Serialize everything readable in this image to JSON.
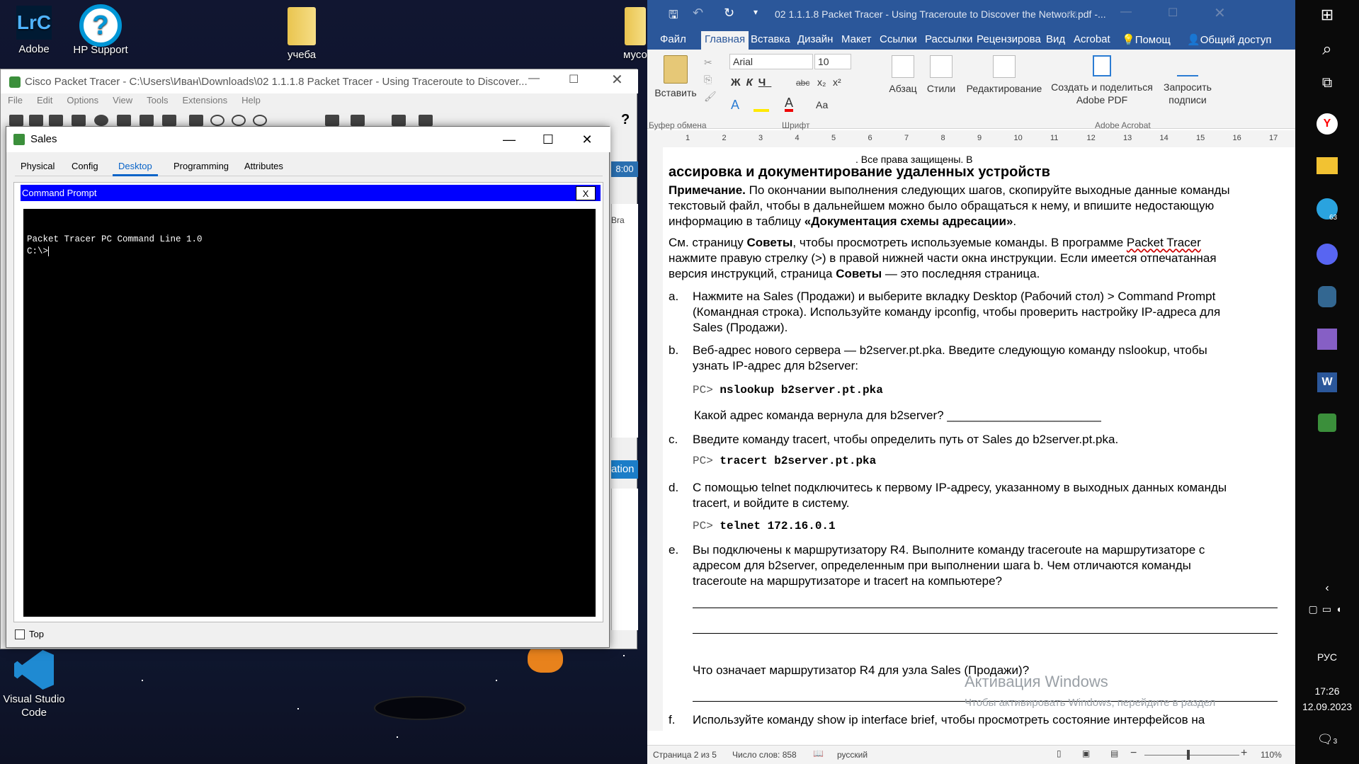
{
  "desktop": {
    "icons": [
      {
        "label": "Adobe",
        "icon": "lightroom-classic-icon",
        "glyph": "LrC"
      },
      {
        "label": "HP Support",
        "icon": "hp-support-icon",
        "glyph": "?"
      },
      {
        "label": "учеба",
        "icon": "folder-icon"
      },
      {
        "label": "мусо",
        "icon": "folder-icon"
      },
      {
        "label": "Visual Studio Code",
        "icon": "vscode-icon"
      }
    ]
  },
  "packet_tracer": {
    "title": "Cisco Packet Tracer - C:\\Users\\Иван\\Downloads\\02 1.1.1.8 Packet Tracer - Using Traceroute to Discover...",
    "menu": [
      "File",
      "Edit",
      "Options",
      "View",
      "Tools",
      "Extensions",
      "Help"
    ],
    "side_clock": "8:00",
    "side_label": "ation",
    "side_bra": "Bra",
    "help_icon": "?"
  },
  "sales_window": {
    "title": "Sales",
    "tabs": [
      "Physical",
      "Config",
      "Desktop",
      "Programming",
      "Attributes"
    ],
    "active_tab": "Desktop",
    "cmd_title": "Command Prompt",
    "cmd_close": "X",
    "terminal_lines": [
      "Packet Tracer PC Command Line 1.0",
      "C:\\>"
    ],
    "top_checkbox_label": "Top"
  },
  "word": {
    "title": "02 1.1.1.8 Packet Tracer - Using Traceroute to Discover the Network.pdf -...",
    "tabs": [
      "Файл",
      "Главная",
      "Вставка",
      "Дизайн",
      "Макет",
      "Ссылки",
      "Рассылки",
      "Рецензирова",
      "Вид",
      "Acrobat",
      "Помощ",
      "Общий доступ"
    ],
    "active_tab": "Главная",
    "ribbon": {
      "paste": "Вставить",
      "clipboard_group": "Буфер обмена",
      "font_name": "Arial",
      "font_size": "10",
      "font_group": "Шрифт",
      "paragraph": "Абзац",
      "styles": "Стили",
      "editing": "Редактирование",
      "create_pdf": "Создать и поделиться Adobe PDF",
      "request_sign": "Запросить подписи",
      "acrobat_group": "Adobe Acrobat"
    },
    "ruler_marks": [
      "1",
      "2",
      "3",
      "4",
      "5",
      "6",
      "7",
      "8",
      "9",
      "10",
      "11",
      "12",
      "13",
      "14",
      "15",
      "16",
      "17"
    ],
    "doc": {
      "rights": ". Все права защищены. В",
      "heading": "ассировка и документирование удаленных устройств",
      "note_label": "Примечание.",
      "note_l1": " По окончании выполнения следующих шагов, скопируйте выходные данные команды",
      "note_l2": "текстовый файл, чтобы в дальнейшем можно было обращаться к нему, и впишите недостающую",
      "note_l3a": "информацию в таблицу ",
      "note_l3b": "«Документация схемы адресации»",
      "note_l3c": ".",
      "tips_l1a": "См. страницу ",
      "tips_l1b": "Советы",
      "tips_l1c": ", чтобы просмотреть используемые команды. В программе ",
      "tips_l1d": "Packet Tracer",
      "tips_l2": "нажмите правую стрелку (>) в правой нижней части окна инструкции. Если имеется отпечатанная",
      "tips_l3a": "версия инструкций, страница ",
      "tips_l3b": "Советы",
      "tips_l3c": " — это последняя страница.",
      "a_mark": "a.",
      "a_l1": "Нажмите на Sales (Продажи) и выберите вкладку Desktop (Рабочий стол) > Command Prompt",
      "a_l2": "(Командная строка). Используйте команду ipconfig, чтобы проверить настройку IP-адреса для",
      "a_l3": "Sales (Продажи).",
      "b_mark": "b.",
      "b_l1": "Веб-адрес нового сервера — b2server.pt.pka. Введите следующую команду nslookup, чтобы",
      "b_l2": "узнать IP-адрес для b2server:",
      "b_cmd_prompt": "PC> ",
      "b_cmd": "nslookup b2server.pt.pka",
      "b_q": "Какой адрес команда вернула для b2server? _______________________",
      "c_mark": "c.",
      "c_l1": "Введите команду tracert, чтобы определить путь от Sales до b2server.pt.pka.",
      "c_cmd_prompt": "PC> ",
      "c_cmd": "tracert b2server.pt.pka",
      "d_mark": "d.",
      "d_l1": "С помощью telnet подключитесь к первому IP-адресу, указанному в выходных данных команды",
      "d_l2": "tracert, и войдите в систему.",
      "d_cmd_prompt": "PC> ",
      "d_cmd": "telnet 172.16.0.1",
      "e_mark": "e.",
      "e_l1": "Вы подключены к маршрутизатору R4. Выполните команду traceroute на маршрутизаторе с",
      "e_l2": "адресом для b2server, определенным при выполнении шага b. Чем отличаются команды",
      "e_l3": "traceroute на маршрутизаторе и tracert на компьютере?",
      "e_q": "Что означает маршрутизатор R4 для узла Sales (Продажи)?",
      "f_mark": "f.",
      "f_l1": "Используйте команду show ip interface brief, чтобы просмотреть состояние интерфейсов на"
    },
    "activation_title": "Активация Windows",
    "activation_sub": "Чтобы активировать Windows, перейдите в раздел",
    "status": {
      "page": "Страница 2 из 5",
      "words": "Число слов: 858",
      "lang": "русский",
      "zoom": "110%"
    }
  },
  "taskbar": {
    "lang": "РУС",
    "time": "17:26",
    "date": "12.09.2023",
    "notif_count": "3",
    "telegram_badge": "63"
  },
  "colors": {
    "word_blue": "#2b579a",
    "cmd_blue": "#0000ff",
    "terminal_bg": "#000000"
  }
}
